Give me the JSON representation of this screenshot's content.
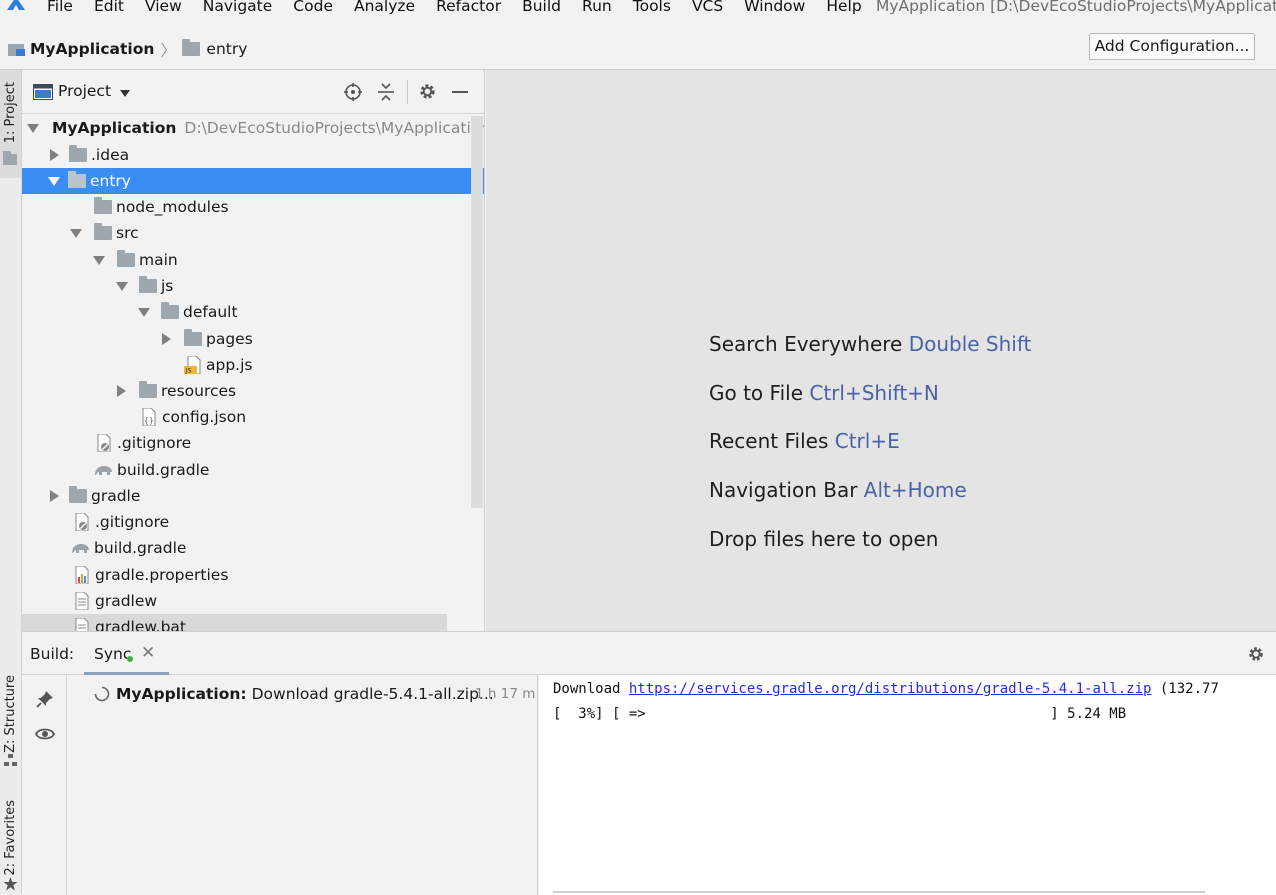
{
  "menubar": {
    "items": [
      "File",
      "Edit",
      "View",
      "Navigate",
      "Code",
      "Analyze",
      "Refactor",
      "Build",
      "Run",
      "Tools",
      "VCS",
      "Window",
      "Help"
    ],
    "window_title": "MyApplication [D:\\DevEcoStudioProjects\\MyApplicatic"
  },
  "navbar": {
    "project": "MyApplication",
    "module": "entry",
    "add_config": "Add Configuration..."
  },
  "left_strip": {
    "project_tab": "1: Project",
    "structure_tab": "Z: Structure",
    "favorites_tab": "2: Favorites"
  },
  "project_panel": {
    "view_selector": "Project",
    "root_name": "MyApplication",
    "root_path": "D:\\DevEcoStudioProjects\\MyApplication",
    "items": [
      {
        "label": ".idea"
      },
      {
        "label": "entry"
      },
      {
        "label": "node_modules"
      },
      {
        "label": "src"
      },
      {
        "label": "main"
      },
      {
        "label": "js"
      },
      {
        "label": "default"
      },
      {
        "label": "pages"
      },
      {
        "label": "app.js"
      },
      {
        "label": "resources"
      },
      {
        "label": "config.json"
      },
      {
        "label": ".gitignore"
      },
      {
        "label": "build.gradle"
      },
      {
        "label": "gradle"
      },
      {
        "label": ".gitignore"
      },
      {
        "label": "build.gradle"
      },
      {
        "label": "gradle.properties"
      },
      {
        "label": "gradlew"
      },
      {
        "label": "gradlew.bat"
      }
    ]
  },
  "editor_hints": [
    {
      "text": "Search Everywhere",
      "key": "Double Shift"
    },
    {
      "text": "Go to File",
      "key": "Ctrl+Shift+N"
    },
    {
      "text": "Recent Files",
      "key": "Ctrl+E"
    },
    {
      "text": "Navigation Bar",
      "key": "Alt+Home"
    },
    {
      "text": "Drop files here to open",
      "key": ""
    }
  ],
  "build_panel": {
    "label": "Build:",
    "tab": "Sync",
    "task_name": "MyApplication:",
    "task_desc": "Download gradle-5.4.1-all.zip...",
    "task_time": "1 h 17 m",
    "console_prefix": "Download ",
    "console_url": "https://services.gradle.org/distributions/gradle-5.4.1-all.zip",
    "console_suffix": " (132.77",
    "progress_line": "[  3%] [ =>                                                ] 5.24 MB"
  },
  "colors": {
    "selection": "#3a8ef2",
    "link": "#1a33d6",
    "shortcut": "#4a63a8"
  }
}
